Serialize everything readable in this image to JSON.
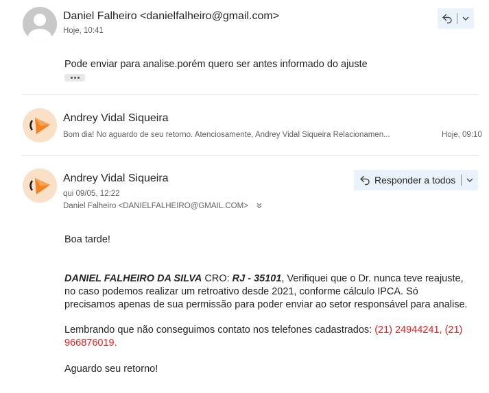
{
  "message1": {
    "sender": "Daniel Falheiro <danielfalheiro@gmail.com>",
    "time": "Hoje, 10:41",
    "body": "Pode enviar para analise.porém quero ser antes informado do ajuste"
  },
  "message2": {
    "sender": "Andrey Vidal Siqueira",
    "preview": "Bom dia! No aguardo de seu retorno. Atenciosamente, Andrey Vidal Siqueira Relacionamen...",
    "time": "Hoje, 09:10"
  },
  "message3": {
    "sender": "Andrey Vidal Siqueira",
    "date": "qui 09/05, 12:22",
    "to": "Daniel Falheiro <DANIELFALHEIRO@GMAIL.COM>",
    "reply_all_label": "Responder a todos",
    "greeting": "Boa tarde!",
    "p1_name": "DANIEL FALHEIRO DA SILVA",
    "p1_cro_label": " CRO: ",
    "p1_cro": "RJ - 35101",
    "p1_text": ", Verifiquei que o Dr. nunca teve reajuste, no caso podemos realizar um retroativo desde 2021, conforme cálculo IPCA. Só precisamos apenas de sua permissão para poder enviar ao setor responsável para analise.",
    "p2_text": "Lembrando que não conseguimos contato nos telefones cadastrados: ",
    "p2_phones": "(21) 24944241, (21) 966876019.",
    "closing": "Aguardo seu retorno!"
  },
  "colors": {
    "brand_orange": "#f58220",
    "avatar_bg": "#fbe0c8",
    "button_bg": "#eaf2fb",
    "phone_red": "#e02020"
  }
}
